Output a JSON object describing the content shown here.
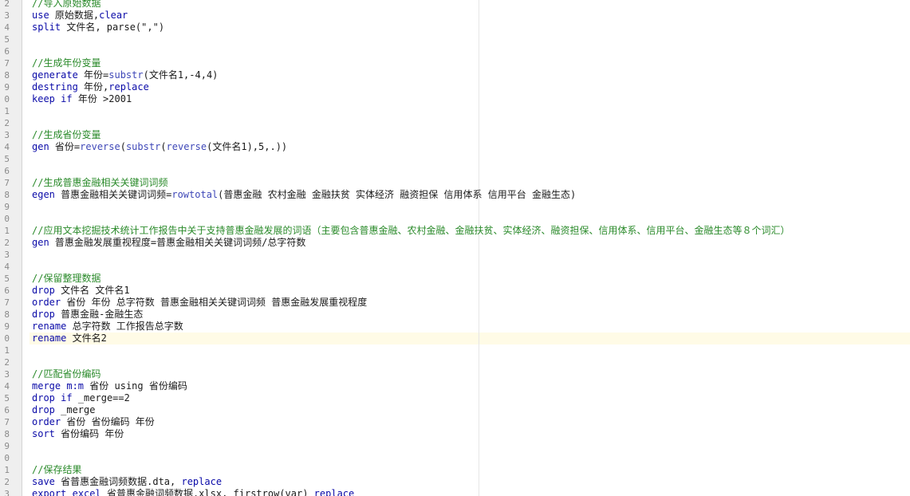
{
  "editor": {
    "lines": [
      {
        "num": "2",
        "tokens": [
          {
            "t": "//导入原始数据",
            "c": "cm"
          }
        ]
      },
      {
        "num": "3",
        "tokens": [
          {
            "t": "use",
            "c": "kw"
          },
          {
            "t": " 原始数据,",
            "c": "pl"
          },
          {
            "t": "clear",
            "c": "kw"
          }
        ]
      },
      {
        "num": "4",
        "tokens": [
          {
            "t": "split",
            "c": "kw"
          },
          {
            "t": " 文件名, parse(\",\")",
            "c": "pl"
          }
        ]
      },
      {
        "num": "5",
        "tokens": []
      },
      {
        "num": "6",
        "tokens": []
      },
      {
        "num": "7",
        "tokens": [
          {
            "t": "//生成年份变量",
            "c": "cm"
          }
        ]
      },
      {
        "num": "8",
        "tokens": [
          {
            "t": "generate",
            "c": "kw"
          },
          {
            "t": " 年份=",
            "c": "pl"
          },
          {
            "t": "substr",
            "c": "fn"
          },
          {
            "t": "(文件名1,-4,4)",
            "c": "pl"
          }
        ]
      },
      {
        "num": "9",
        "tokens": [
          {
            "t": "destring",
            "c": "kw"
          },
          {
            "t": " 年份,",
            "c": "pl"
          },
          {
            "t": "replace",
            "c": "kw"
          }
        ]
      },
      {
        "num": "0",
        "tokens": [
          {
            "t": "keep",
            "c": "kw"
          },
          {
            "t": " ",
            "c": "pl"
          },
          {
            "t": "if",
            "c": "kw"
          },
          {
            "t": " 年份 >2001",
            "c": "pl"
          }
        ]
      },
      {
        "num": "1",
        "tokens": []
      },
      {
        "num": "2",
        "tokens": []
      },
      {
        "num": "3",
        "tokens": [
          {
            "t": "//生成省份变量",
            "c": "cm"
          }
        ]
      },
      {
        "num": "4",
        "tokens": [
          {
            "t": "gen",
            "c": "kw"
          },
          {
            "t": " 省份=",
            "c": "pl"
          },
          {
            "t": "reverse",
            "c": "fn"
          },
          {
            "t": "(",
            "c": "pl"
          },
          {
            "t": "substr",
            "c": "fn"
          },
          {
            "t": "(",
            "c": "pl"
          },
          {
            "t": "reverse",
            "c": "fn"
          },
          {
            "t": "(文件名1),5,.))",
            "c": "pl"
          }
        ]
      },
      {
        "num": "5",
        "tokens": []
      },
      {
        "num": "6",
        "tokens": []
      },
      {
        "num": "7",
        "tokens": [
          {
            "t": "//生成普惠金融相关关键词词频",
            "c": "cm"
          }
        ]
      },
      {
        "num": "8",
        "tokens": [
          {
            "t": "egen",
            "c": "kw"
          },
          {
            "t": " 普惠金融相关关键词词频=",
            "c": "pl"
          },
          {
            "t": "rowtotal",
            "c": "fn"
          },
          {
            "t": "(普惠金融 农村金融 金融扶贫 实体经济 融资担保 信用体系 信用平台 金融生态)",
            "c": "pl"
          }
        ]
      },
      {
        "num": "9",
        "tokens": []
      },
      {
        "num": "0",
        "tokens": []
      },
      {
        "num": "1",
        "tokens": [
          {
            "t": "//应用文本挖掘技术统计工作报告中关于支持普惠金融发展的词语（主要包含普惠金融、农村金融、金融扶贫、实体经济、融资担保、信用体系、信用平台、金融生态等８个词汇）",
            "c": "cm"
          }
        ]
      },
      {
        "num": "2",
        "tokens": [
          {
            "t": "gen",
            "c": "kw"
          },
          {
            "t": " 普惠金融发展重视程度=普惠金融相关关键词词频/总字符数",
            "c": "pl"
          }
        ]
      },
      {
        "num": "3",
        "tokens": []
      },
      {
        "num": "4",
        "tokens": []
      },
      {
        "num": "5",
        "tokens": [
          {
            "t": "//保留整理数据",
            "c": "cm"
          }
        ]
      },
      {
        "num": "6",
        "tokens": [
          {
            "t": "drop",
            "c": "kw"
          },
          {
            "t": " 文件名 文件名1",
            "c": "pl"
          }
        ]
      },
      {
        "num": "7",
        "tokens": [
          {
            "t": "order",
            "c": "kw"
          },
          {
            "t": " 省份 年份 总字符数 普惠金融相关关键词词频 普惠金融发展重视程度",
            "c": "pl"
          }
        ]
      },
      {
        "num": "8",
        "tokens": [
          {
            "t": "drop",
            "c": "kw"
          },
          {
            "t": " 普惠金融-金融生态",
            "c": "pl"
          }
        ]
      },
      {
        "num": "9",
        "tokens": [
          {
            "t": "rename",
            "c": "kw"
          },
          {
            "t": " 总字符数 工作报告总字数",
            "c": "pl"
          }
        ]
      },
      {
        "num": "0",
        "tokens": [
          {
            "t": "rename",
            "c": "kw"
          },
          {
            "t": " 文件名2",
            "c": "pl"
          }
        ]
      },
      {
        "num": "1",
        "tokens": []
      },
      {
        "num": "2",
        "tokens": []
      },
      {
        "num": "3",
        "tokens": [
          {
            "t": "//匹配省份编码",
            "c": "cm"
          }
        ]
      },
      {
        "num": "4",
        "tokens": [
          {
            "t": "merge",
            "c": "kw"
          },
          {
            "t": " ",
            "c": "pl"
          },
          {
            "t": "m:m",
            "c": "kw"
          },
          {
            "t": " 省份 using 省份编码",
            "c": "pl"
          }
        ]
      },
      {
        "num": "5",
        "tokens": [
          {
            "t": "drop",
            "c": "kw"
          },
          {
            "t": " ",
            "c": "pl"
          },
          {
            "t": "if",
            "c": "kw"
          },
          {
            "t": " _merge==2",
            "c": "pl"
          }
        ]
      },
      {
        "num": "6",
        "tokens": [
          {
            "t": "drop",
            "c": "kw"
          },
          {
            "t": " _merge",
            "c": "pl"
          }
        ]
      },
      {
        "num": "7",
        "tokens": [
          {
            "t": "order",
            "c": "kw"
          },
          {
            "t": " 省份 省份编码 年份",
            "c": "pl"
          }
        ]
      },
      {
        "num": "8",
        "tokens": [
          {
            "t": "sort",
            "c": "kw"
          },
          {
            "t": " 省份编码 年份",
            "c": "pl"
          }
        ]
      },
      {
        "num": "9",
        "tokens": []
      },
      {
        "num": "0",
        "tokens": []
      },
      {
        "num": "1",
        "tokens": [
          {
            "t": "//保存结果",
            "c": "cm"
          }
        ]
      },
      {
        "num": "2",
        "tokens": [
          {
            "t": "save",
            "c": "kw"
          },
          {
            "t": " 省普惠金融词频数据.dta, ",
            "c": "pl"
          },
          {
            "t": "replace",
            "c": "kw"
          }
        ]
      },
      {
        "num": "3",
        "tokens": [
          {
            "t": "export",
            "c": "kw"
          },
          {
            "t": " ",
            "c": "pl"
          },
          {
            "t": "excel",
            "c": "kw"
          },
          {
            "t": " 省普惠金融词频数据.xlsx, firstrow(var) ",
            "c": "pl"
          },
          {
            "t": "replace",
            "c": "kw"
          }
        ]
      }
    ]
  }
}
